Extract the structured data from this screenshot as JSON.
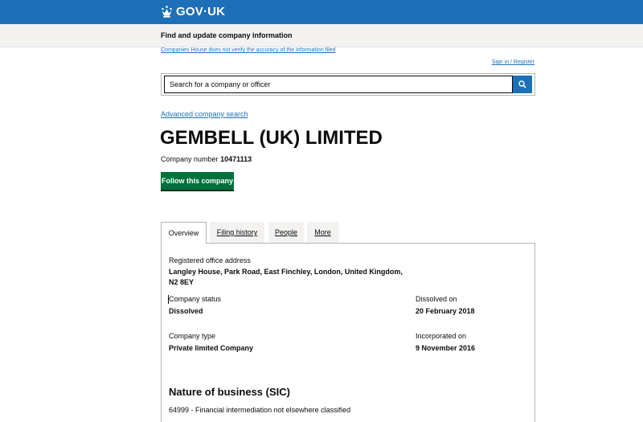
{
  "header": {
    "logo_text": "GOV·UK",
    "logo_icon": "crown-icon",
    "brand_color": "#1d70b8"
  },
  "service": {
    "name": "Find and update company information"
  },
  "disclaimer": "Companies House does not verify the accuracy of the information filed",
  "account": {
    "signin_label": "Sign in / Register"
  },
  "search": {
    "placeholder": "Search for a company or officer",
    "button_icon": "search-icon"
  },
  "advanced_search_label": "Advanced company search",
  "company": {
    "name": "GEMBELL (UK) LIMITED",
    "number_label": "Company number",
    "number": "10471113",
    "follow_label": "Follow this company",
    "follow_color": "#00703c"
  },
  "tabs": [
    {
      "label": "Overview",
      "active": true
    },
    {
      "label": "Filing history",
      "active": false
    },
    {
      "label": "People",
      "active": false
    },
    {
      "label": "More",
      "active": false
    }
  ],
  "overview": {
    "registered_office": {
      "label": "Registered office address",
      "line1": "Langley House, Park Road, East Finchley, London, United Kingdom,",
      "line2": "N2 8EY"
    },
    "status": {
      "label": "Company status",
      "value": "Dissolved"
    },
    "dissolved_on": {
      "label": "Dissolved on",
      "value": "20 February 2018"
    },
    "type": {
      "label": "Company type",
      "value": "Private limited Company"
    },
    "incorporated_on": {
      "label": "Incorporated on",
      "value": "9 November 2016"
    },
    "sic": {
      "title": "Nature of business (SIC)",
      "items": [
        "64999 - Financial intermediation not elsewhere classified"
      ]
    }
  }
}
